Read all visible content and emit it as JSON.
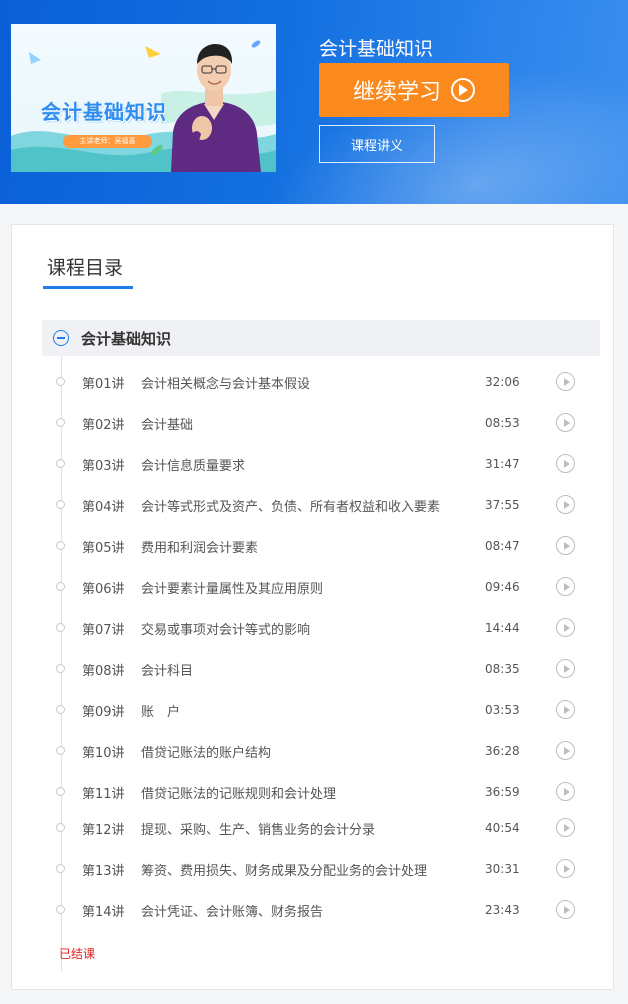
{
  "header": {
    "thumbnail": {
      "title": "会计基础知识",
      "teacher": "主讲老师：吴福喜"
    },
    "course_title": "会计基础知识",
    "continue_label": "继续学习",
    "notes_label": "课程讲义"
  },
  "catalog": {
    "title": "课程目录",
    "chapter_title": "会计基础知识",
    "lessons": [
      {
        "num": "第01讲",
        "name": "会计相关概念与会计基本假设",
        "duration": "32:06"
      },
      {
        "num": "第02讲",
        "name": "会计基础",
        "duration": "08:53"
      },
      {
        "num": "第03讲",
        "name": "会计信息质量要求",
        "duration": "31:47"
      },
      {
        "num": "第04讲",
        "name": "会计等式形式及资产、负债、所有者权益和收入要素",
        "duration": "37:55"
      },
      {
        "num": "第05讲",
        "name": "费用和利润会计要素",
        "duration": "08:47"
      },
      {
        "num": "第06讲",
        "name": "会计要素计量属性及其应用原则",
        "duration": "09:46"
      },
      {
        "num": "第07讲",
        "name": "交易或事项对会计等式的影响",
        "duration": "14:44"
      },
      {
        "num": "第08讲",
        "name": "会计科目",
        "duration": "08:35"
      },
      {
        "num": "第09讲",
        "name": "账　户",
        "duration": "03:53"
      },
      {
        "num": "第10讲",
        "name": "借贷记账法的账户结构",
        "duration": "36:28"
      },
      {
        "num": "第11讲",
        "name": "借贷记账法的记账规则和会计处理",
        "duration": "36:59"
      },
      {
        "num": "第12讲",
        "name": "提现、采购、生产、销售业务的会计分录",
        "duration": "40:54"
      },
      {
        "num": "第13讲",
        "name": "筹资、费用损失、财务成果及分配业务的会计处理",
        "duration": "30:31"
      },
      {
        "num": "第14讲",
        "name": "会计凭证、会计账簿、财务报告",
        "duration": "23:43"
      }
    ],
    "status": "已结课"
  }
}
